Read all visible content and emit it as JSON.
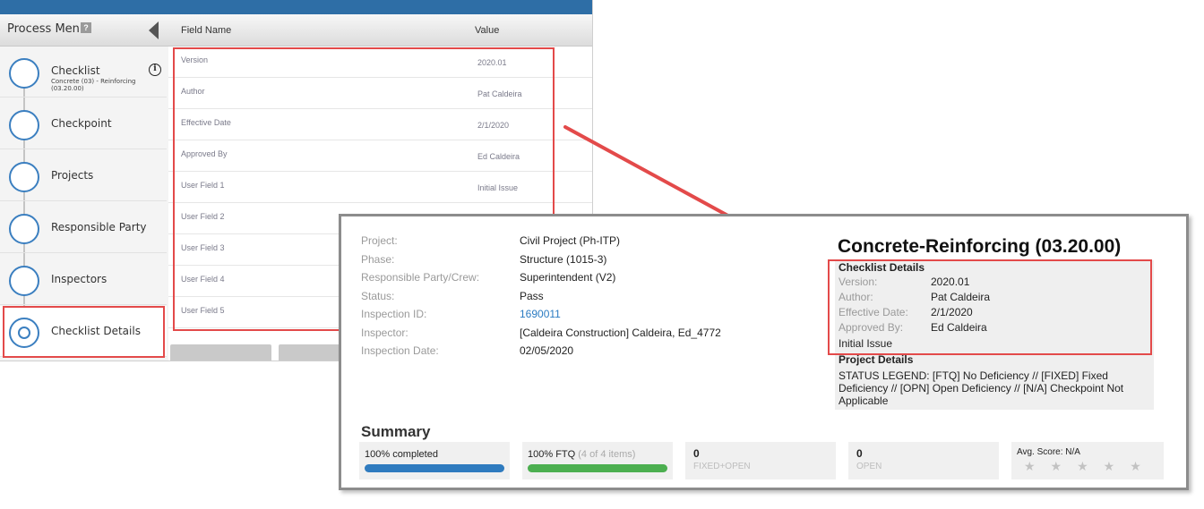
{
  "process_menu": {
    "title": "Process Menu",
    "help": "?",
    "steps": [
      {
        "label": "Checklist",
        "sub": "Concrete (03) - Reinforcing (03.20.00)"
      },
      {
        "label": "Checkpoint"
      },
      {
        "label": "Projects"
      },
      {
        "label": "Responsible Party"
      },
      {
        "label": "Inspectors"
      },
      {
        "label": "Checklist Details",
        "active": true
      }
    ]
  },
  "table": {
    "col_field": "Field Name",
    "col_value": "Value",
    "rows": [
      {
        "field": "Version",
        "value": "2020.01"
      },
      {
        "field": "Author",
        "value": "Pat Caldeira"
      },
      {
        "field": "Effective Date",
        "value": "2/1/2020"
      },
      {
        "field": "Approved By",
        "value": "Ed Caldeira"
      },
      {
        "field": "User Field 1",
        "value": "Initial Issue"
      },
      {
        "field": "User Field 2",
        "value": ""
      },
      {
        "field": "User Field 3",
        "value": ""
      },
      {
        "field": "User Field 4",
        "value": ""
      },
      {
        "field": "User Field 5",
        "value": ""
      }
    ]
  },
  "report": {
    "info": [
      {
        "label": "Project:",
        "value": "Civil Project (Ph-ITP)"
      },
      {
        "label": "Phase:",
        "value": "Structure (1015-3)"
      },
      {
        "label": "Responsible Party/Crew:",
        "value": "Superintendent (V2)"
      },
      {
        "label": "Status:",
        "value": "Pass"
      },
      {
        "label": "Inspection ID:",
        "value": "1690011"
      },
      {
        "label": "Inspector:",
        "value": "[Caldeira Construction] Caldeira, Ed_4772"
      },
      {
        "label": "Inspection Date:",
        "value": "02/05/2020"
      }
    ],
    "title": "Concrete-Reinforcing (03.20.00)",
    "checklist_details": {
      "heading": "Checklist Details",
      "rows": [
        {
          "label": "Version:",
          "value": "2020.01"
        },
        {
          "label": "Author:",
          "value": "Pat Caldeira"
        },
        {
          "label": "Effective Date:",
          "value": "2/1/2020"
        },
        {
          "label": "Approved By:",
          "value": "Ed Caldeira"
        }
      ],
      "extra": "Initial Issue"
    },
    "project_details": {
      "heading": "Project Details",
      "legend": "STATUS LEGEND: [FTQ] No Deficiency // [FIXED] Fixed Deficiency // [OPN] Open Deficiency // [N/A] Checkpoint Not Applicable"
    },
    "summary": {
      "title": "Summary",
      "completed": {
        "text": "100% completed",
        "progress": 1.0,
        "color": "#2f7bbf"
      },
      "ftq": {
        "text": "100% FTQ",
        "muted": "(4 of 4 items)",
        "progress": 1.0,
        "color": "#4caf50"
      },
      "fixed_open": {
        "count": "0",
        "label": "FIXED+OPEN"
      },
      "open": {
        "count": "0",
        "label": "OPEN"
      },
      "avg_score": {
        "text": "Avg. Score: N/A",
        "stars": "★★★★★",
        "rating": 0
      }
    }
  },
  "colors": {
    "highlight": "#e34a4a",
    "accent": "#2e6ea6"
  }
}
